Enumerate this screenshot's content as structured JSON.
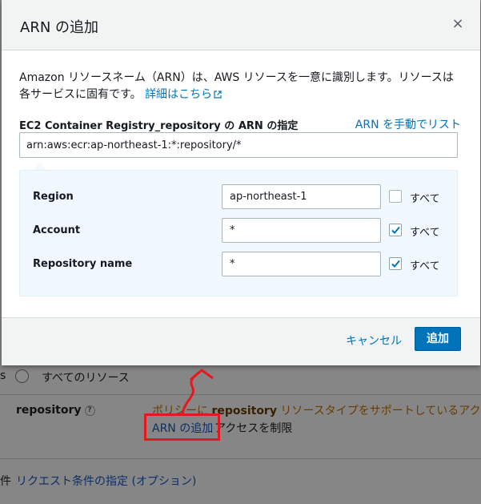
{
  "modal": {
    "title": "ARN の追加",
    "close_symbol": "×",
    "description": "Amazon リソースネーム（ARN）は、AWS リソースを一意に識別します。リソースは各サービスに固有です。",
    "details_link": "詳細はこちら",
    "field_label": "EC2 Container Registry_repository の ARN の指定",
    "manual_link": "ARN を手動でリスト",
    "arn_value": "arn:aws:ecr:ap-northeast-1:*:repository/*",
    "rows": [
      {
        "label": "Region",
        "value": "ap-northeast-1",
        "all_label": "すべて",
        "all_checked": false
      },
      {
        "label": "Account",
        "value": "*",
        "all_label": "すべて",
        "all_checked": true
      },
      {
        "label": "Repository name",
        "value": "*",
        "all_label": "すべて",
        "all_checked": true
      }
    ],
    "cancel_label": "キャンセル",
    "add_label": "追加"
  },
  "background": {
    "all_resources": "すべてのリソース",
    "resource_label": "repository",
    "help_symbol": "?",
    "warning_pre": "ポリシーに",
    "warning_bold": "repository",
    "warning_post": "リソースタイプをサポートしているアクシ",
    "arn_link": "ARN の追加",
    "arn_rest": "アクセスを制限",
    "conditions_link": "リクエスト条件の指定 (オプション)",
    "cut_text_1": "s",
    "cut_text_2": "件"
  },
  "colors": {
    "link": "#0073bb",
    "primary_button": "#0073bb",
    "annotation": "#e4181e",
    "panel_bg": "#f1f8fe"
  },
  "icons": [
    "close-icon",
    "external-link-icon",
    "check-icon",
    "help-icon",
    "annotation-arrow"
  ]
}
